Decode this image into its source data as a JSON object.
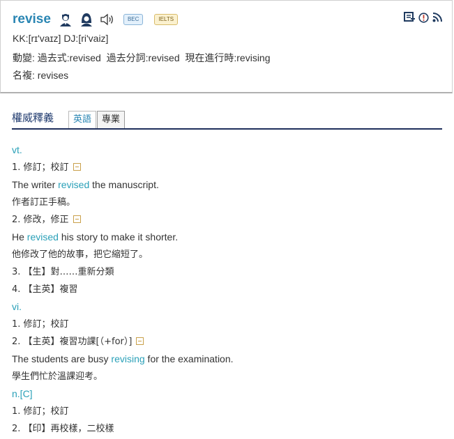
{
  "header": {
    "word": "revise",
    "bec_badge": "BEC",
    "ielts_badge": "IELTS",
    "pronunciation": "KK:[rɪ'vaɪz] DJ:[ri'vaiz]",
    "inflections": "動變: 過去式:revised  過去分詞:revised  現在進行時:revising",
    "plural": "名複: revises"
  },
  "section": {
    "title": "權威釋義",
    "tabs": [
      "英語",
      "專業"
    ]
  },
  "defs": {
    "pos_vt": "vt.",
    "vt1": "1. 修訂；校訂",
    "vt1_ex_pre": "The writer ",
    "vt1_ex_kw": "revised",
    "vt1_ex_post": " the manuscript.",
    "vt1_tr": "作者訂正手稿。",
    "vt2": "2. 修改，修正",
    "vt2_ex_pre": "He ",
    "vt2_ex_kw": "revised",
    "vt2_ex_post": " his story to make it shorter.",
    "vt2_tr": "他修改了他的故事，把它縮短了。",
    "vt3": "3. 【生】對……重新分類",
    "vt4": "4. 【主英】複習",
    "pos_vi": "vi.",
    "vi1": "1. 修訂；校訂",
    "vi2": "2. 【主英】複習功課[（+for）]",
    "vi2_ex_pre": "The students are busy ",
    "vi2_ex_kw": "revising",
    "vi2_ex_post": " for the examination.",
    "vi2_tr": "學生們忙於溫課迎考。",
    "pos_n": "n.[C]",
    "n1": "1. 修訂；校訂",
    "n2": "2. 【印】再校樣，二校樣"
  },
  "icons": [
    "male-avatar-icon",
    "female-avatar-icon",
    "speaker-icon",
    "add-to-wordbook-icon",
    "report-error-icon",
    "rss-icon",
    "collapse-icon"
  ],
  "colors": {
    "headword": "#2a86b3",
    "highlight": "#2aa0b8",
    "section_rule": "#1f2f5c"
  }
}
